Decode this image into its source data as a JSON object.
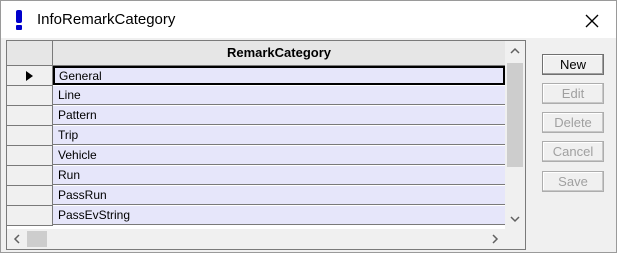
{
  "window": {
    "title": "InfoRemarkCategory",
    "close_icon": "close-icon"
  },
  "grid": {
    "column_header": "RemarkCategory",
    "current_row": 0,
    "rows": [
      "General",
      "Line",
      "Pattern",
      "Trip",
      "Vehicle",
      "Run",
      "PassRun",
      "PassEvString"
    ]
  },
  "scroll": {
    "up": "⌃",
    "down": "⌄",
    "left": "<",
    "right": ">"
  },
  "buttons": {
    "new_label": "New",
    "edit_label": "Edit",
    "delete_label": "Delete",
    "cancel_label": "Cancel",
    "save_label": "Save"
  },
  "colors": {
    "cell_bg": "#e6e6fa",
    "icon_blue": "#0000cc"
  }
}
